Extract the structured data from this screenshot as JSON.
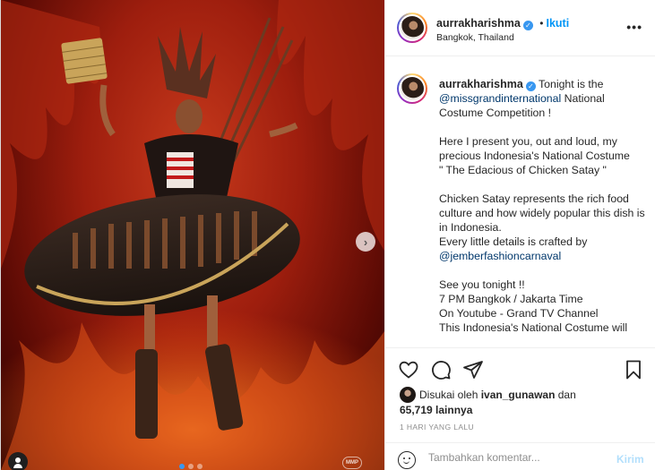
{
  "post": {
    "username": "aurrakharishma",
    "follow_label": "Ikuti",
    "follow_separator": "•",
    "location": "Bangkok, Thailand",
    "more_icon": "more-horizontal-icon"
  },
  "caption": {
    "username": "aurrakharishma",
    "line1_text": "Tonight is the",
    "mention1": "@missgrandinternational",
    "line1_rest": "National Costume Competition !",
    "para2": "Here I present you, out and loud, my precious Indonesia's National Costume",
    "para2_quote": "\" The Edacious of Chicken Satay \"",
    "para3": "Chicken Satay represents the rich food culture and how widely popular this dish is in Indonesia.",
    "para3_line2": "Every little details is crafted by",
    "mention2": "@jemberfashioncarnaval",
    "para4_line1": "See you tonight !!",
    "para4_line2": "7 PM Bangkok / Jakarta Time",
    "para4_line3": "On Youtube - Grand TV Channel",
    "para4_line4": "This Indonesia's National Costume will"
  },
  "actions": {
    "like_icon": "heart-icon",
    "comment_icon": "comment-icon",
    "share_icon": "share-icon",
    "save_icon": "bookmark-icon"
  },
  "likes": {
    "prefix": "Disukai oleh",
    "liker": "ivan_gunawan",
    "conjunction": "dan",
    "count": "65,719 lainnya"
  },
  "timestamp": "1 HARI YANG LALU",
  "comment": {
    "placeholder": "Tambahkan komentar...",
    "post_label": "Kirim"
  },
  "photo": {
    "carousel_count": 3,
    "active_index": 0,
    "next_icon": "chevron-right-icon",
    "tag_icon": "user-tag-icon",
    "watermark": "MMP",
    "next_glyph": "›"
  },
  "colors": {
    "accent": "#0095f6",
    "verified": "#3897f0",
    "mention": "#00376b",
    "muted": "#8e8e8e"
  }
}
